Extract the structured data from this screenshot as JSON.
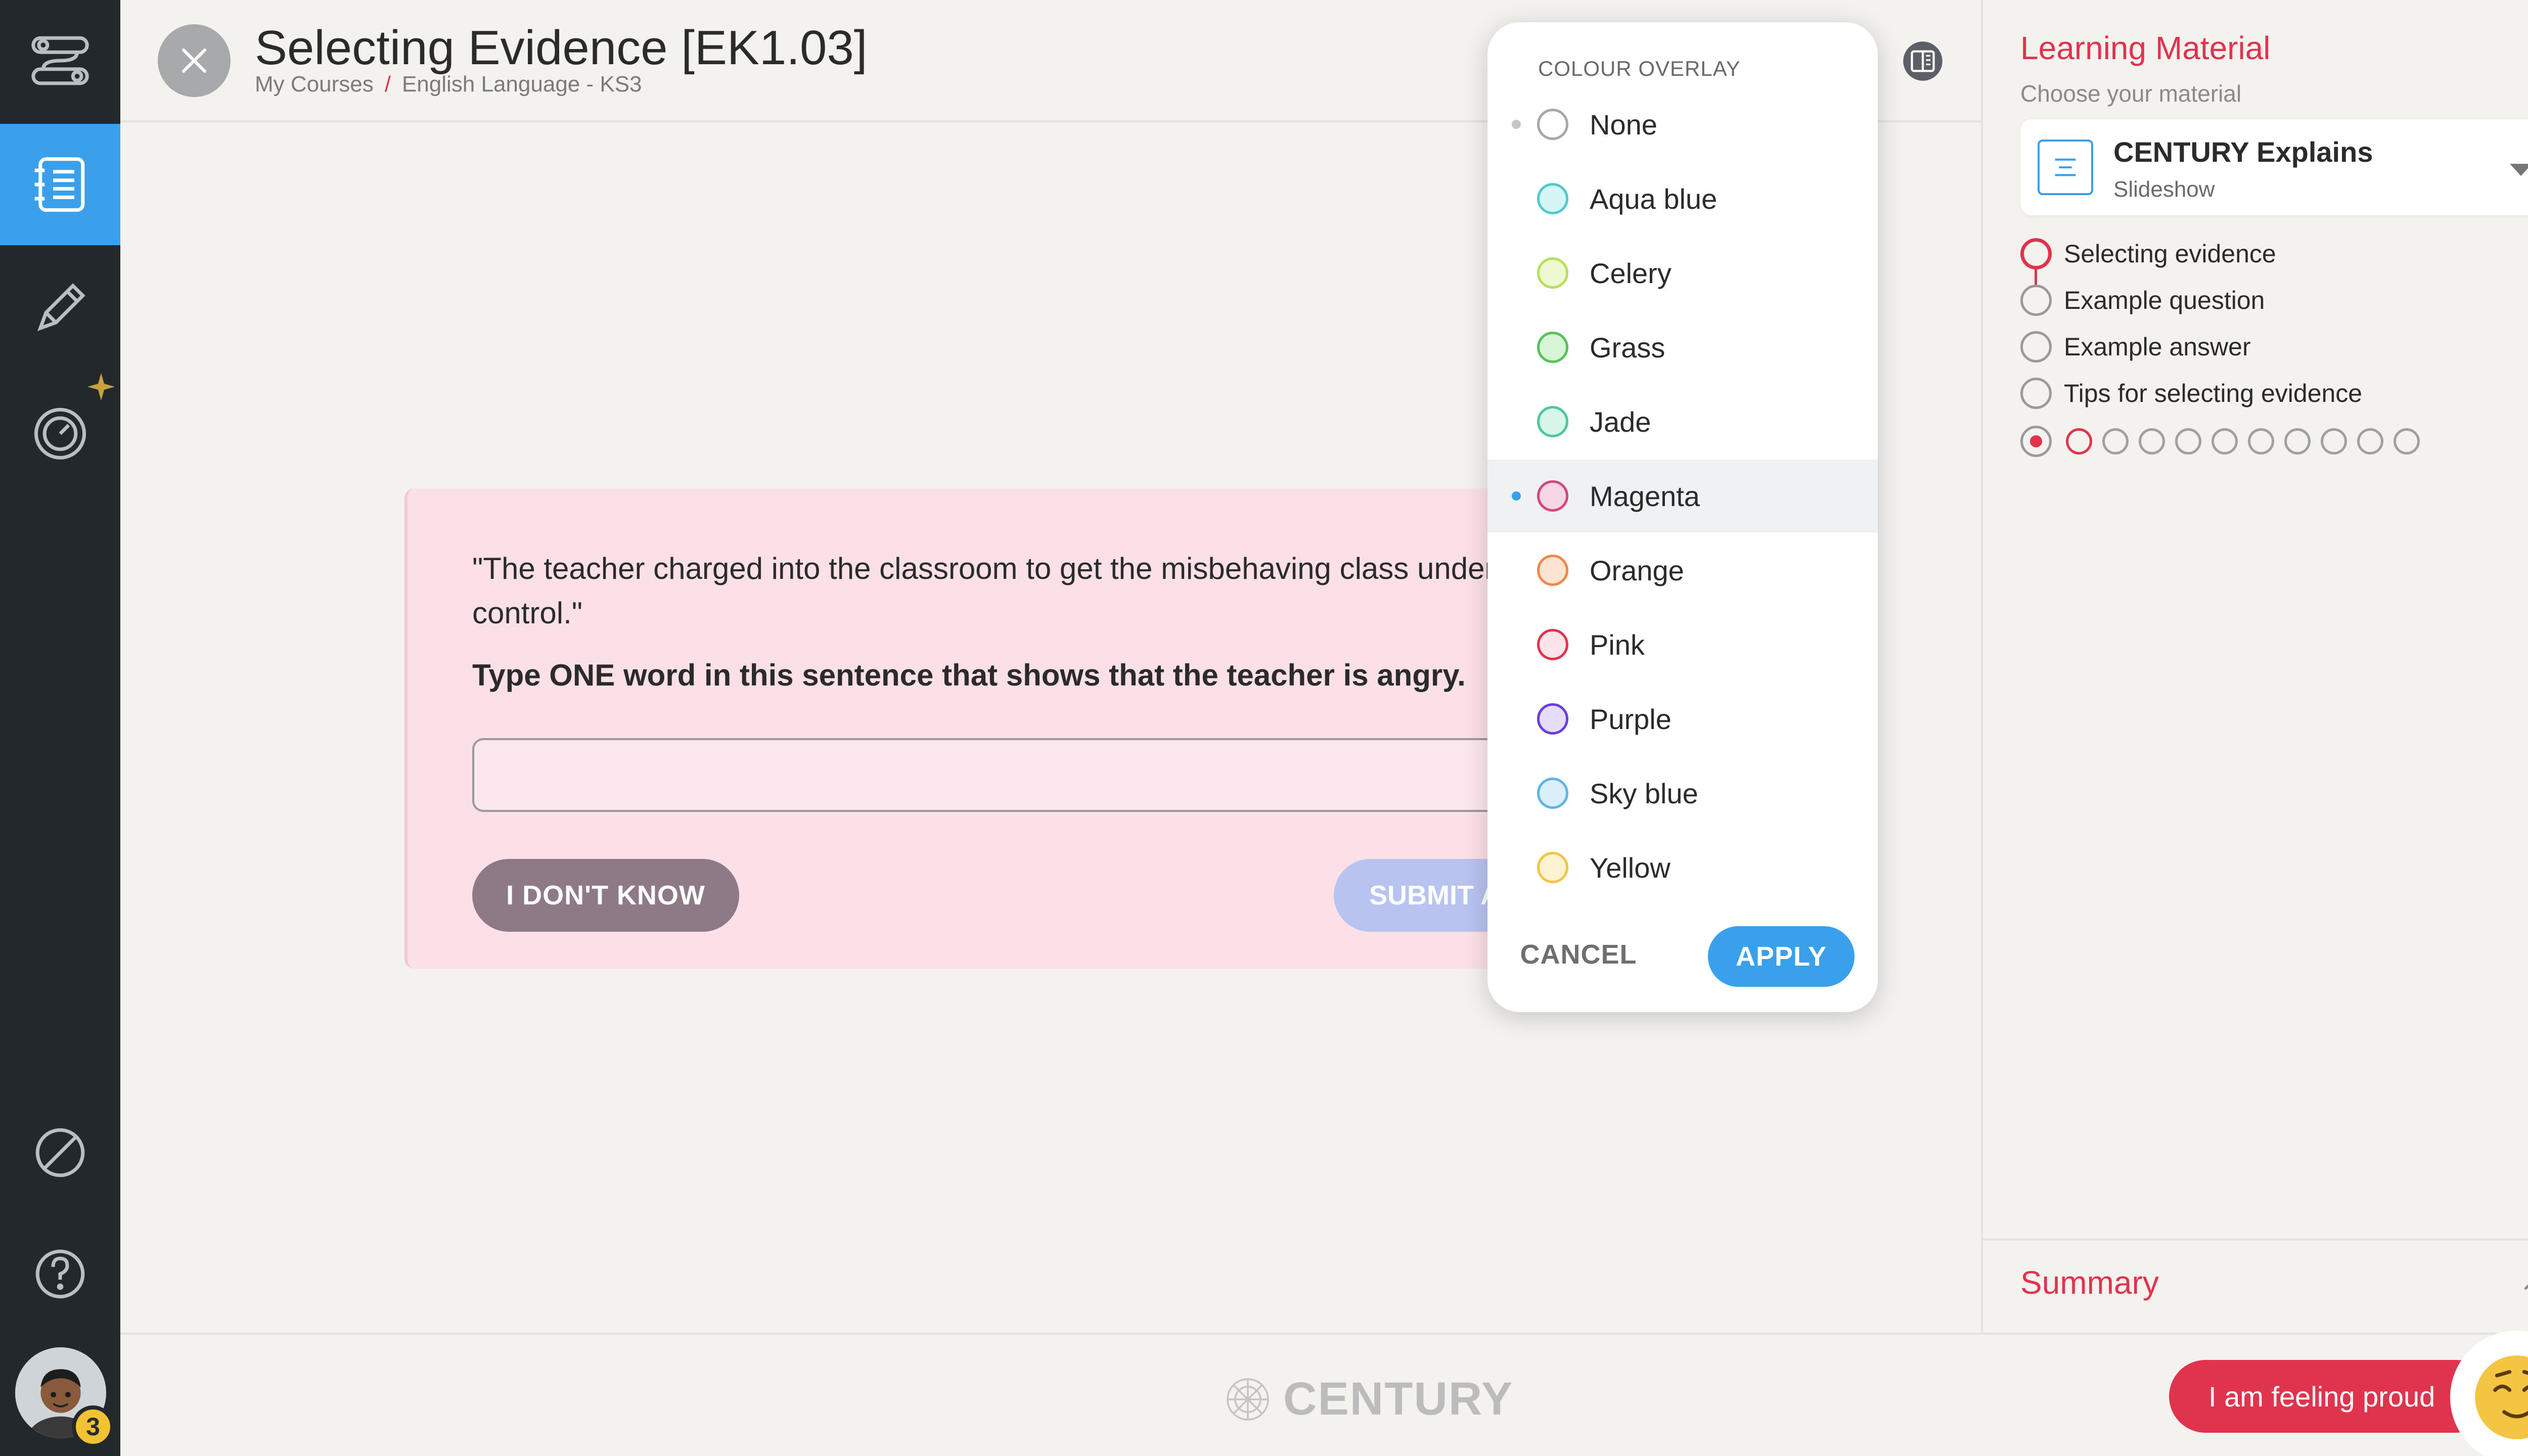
{
  "header": {
    "title": "Selecting Evidence [EK1.03]",
    "breadcrumb": [
      "My Courses",
      "English Language - KS3"
    ],
    "breadcrumb_sep": "/"
  },
  "rail": {
    "items": [
      {
        "icon": "path-nodes-icon",
        "active": false
      },
      {
        "icon": "notebook-icon",
        "active": true
      },
      {
        "icon": "pencil-icon",
        "active": false
      },
      {
        "icon": "gauge-icon",
        "active": false
      }
    ],
    "bottom": [
      {
        "icon": "no-entry-icon"
      },
      {
        "icon": "help-icon"
      }
    ],
    "avatar_badge": "3"
  },
  "question": {
    "quote": "\"The teacher charged into the classroom to get the misbehaving class under control.\"",
    "instruction": "Type ONE word in this sentence that shows that the teacher is angry.",
    "answer_value": "",
    "answer_placeholder": "",
    "dont_know_label": "I DON'T KNOW",
    "submit_label": "SUBMIT ANSWER"
  },
  "colour_overlay": {
    "title": "COLOUR OVERLAY",
    "options": [
      {
        "label": "None",
        "fill": "#ffffff",
        "border": "#a8a8a8",
        "marker": "#c6c6c6"
      },
      {
        "label": "Aqua blue",
        "fill": "#d6f6f6",
        "border": "#54c7cf",
        "marker": ""
      },
      {
        "label": "Celery",
        "fill": "#eef9d2",
        "border": "#b7e05a",
        "marker": ""
      },
      {
        "label": "Grass",
        "fill": "#d9f5d8",
        "border": "#56c35a",
        "marker": ""
      },
      {
        "label": "Jade",
        "fill": "#d9f6ea",
        "border": "#4fc79c",
        "marker": ""
      },
      {
        "label": "Magenta",
        "fill": "#f7d7e6",
        "border": "#d4477f",
        "marker": "#3aa0ec",
        "selected": true
      },
      {
        "label": "Orange",
        "fill": "#fde3d2",
        "border": "#f0884a",
        "marker": ""
      },
      {
        "label": "Pink",
        "fill": "#fde3ea",
        "border": "#e0344e",
        "marker": ""
      },
      {
        "label": "Purple",
        "fill": "#e6dcfb",
        "border": "#6a3fe0",
        "marker": ""
      },
      {
        "label": "Sky blue",
        "fill": "#dbeffb",
        "border": "#5fb6e6",
        "marker": ""
      },
      {
        "label": "Yellow",
        "fill": "#fdf3d0",
        "border": "#f0c64a",
        "marker": ""
      }
    ],
    "cancel_label": "CANCEL",
    "apply_label": "APPLY"
  },
  "learning_material": {
    "title": "Learning Material",
    "subtitle": "Choose your material",
    "selected_main": "CENTURY Explains",
    "selected_sub": "Slideshow",
    "steps": [
      {
        "label": "Selecting evidence",
        "active": true
      },
      {
        "label": "Example question",
        "active": false
      },
      {
        "label": "Example answer",
        "active": false
      },
      {
        "label": "Tips for selecting evidence",
        "active": false
      }
    ],
    "pager": {
      "total": 10,
      "current": 1
    }
  },
  "summary": {
    "label": "Summary"
  },
  "footer": {
    "brand": "CENTURY"
  },
  "mood": {
    "label": "I am feeling proud"
  },
  "colors": {
    "accent_blue": "#3aa0ec",
    "accent_red": "#e0344e",
    "rail_bg": "#23282d",
    "card_bg": "#fce0e8"
  }
}
